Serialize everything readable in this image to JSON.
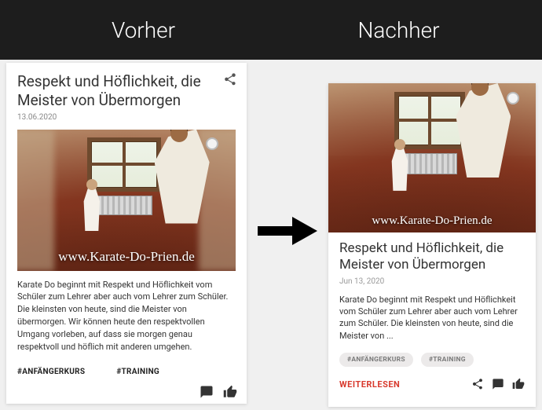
{
  "colors": {
    "read_more": "#d83a2e"
  },
  "comparison": {
    "before_label": "Vorher",
    "after_label": "Nachher"
  },
  "before": {
    "title": "Respekt und Höflichkeit, die Meister von Übermorgen",
    "date": "13.06.2020",
    "image_overlay_url": "www.Karate-Do-Prien.de",
    "excerpt": "Karate Do beginnt mit Respekt und Höflichkeit vom Schüler zum Lehrer aber auch vom Lehrer zum Schüler. Die kleinsten von heute, sind die Meister von übermorgen. Wir können heute den respektvollen Umgang vorleben, auf dass sie morgen genau respektvoll und höflich mit anderen umgehen.",
    "tags": [
      "#ANFÄNGERKURS",
      "#TRAINING"
    ]
  },
  "after": {
    "title": "Respekt und Höflichkeit, die Meister von Übermorgen",
    "date": "Jun 13, 2020",
    "image_overlay_url": "www.Karate-Do-Prien.de",
    "excerpt": "Karate Do beginnt mit Respekt und Höflichkeit vom Schüler zum Lehrer aber auch vom Lehrer zum Schüler. Die kleinsten von heute, sind die Meister von ...",
    "tags": [
      "#ANFÄNGERKURS",
      "#TRAINING"
    ],
    "read_more_label": "WEITERLESEN"
  }
}
